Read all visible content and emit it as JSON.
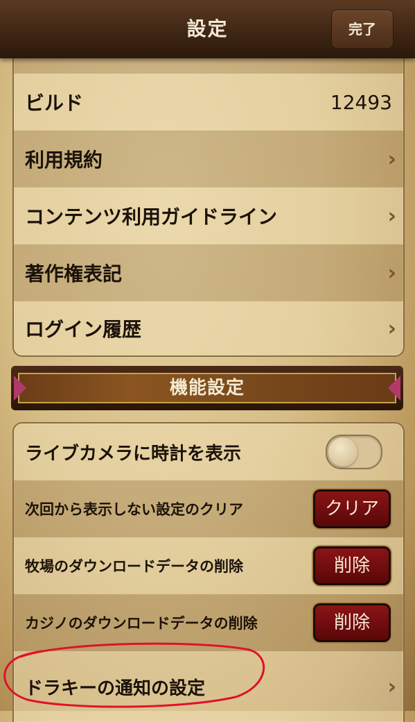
{
  "header": {
    "title": "設定",
    "done_label": "完了"
  },
  "info_list": [
    {
      "label": "ビルド",
      "value": "12493"
    },
    {
      "label": "利用規約",
      "chevron": "›"
    },
    {
      "label": "コンテンツ利用ガイドライン",
      "chevron": "›"
    },
    {
      "label": "著作権表記",
      "chevron": "›"
    },
    {
      "label": "ログイン履歴",
      "chevron": "›"
    }
  ],
  "section": {
    "title": "機能設定"
  },
  "feature_list": [
    {
      "label": "ライブカメラに時計を表示",
      "toggle_on": false
    },
    {
      "label": "次回から表示しない設定のクリア",
      "button": "クリア"
    },
    {
      "label": "牧場のダウンロードデータの削除",
      "button": "削除"
    },
    {
      "label": "カジノのダウンロードデータの削除",
      "button": "削除"
    },
    {
      "label": "ドラキーの通知の設定",
      "chevron": "›"
    }
  ],
  "colors": {
    "header_bg": "#3d2513",
    "parchment": "#d6bd86",
    "button_red": "#7a0e10",
    "annotation_red": "#e0102a"
  }
}
